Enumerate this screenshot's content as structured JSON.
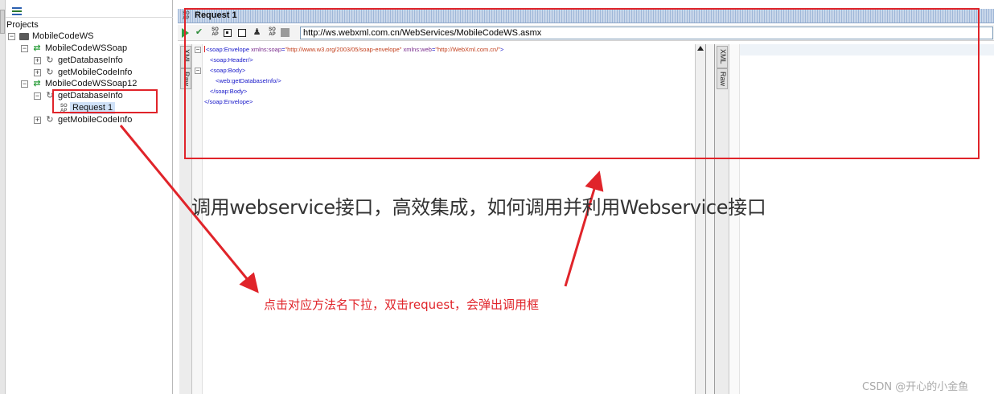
{
  "navigator": {
    "header": "Projects",
    "tree": [
      {
        "label": "MobileCodeWS",
        "icon": "project-folder-icon",
        "expander": "−"
      },
      {
        "label": "MobileCodeWSSoap",
        "icon": "soap-interface-icon",
        "expander": "−"
      },
      {
        "label": "getDatabaseInfo",
        "icon": "operation-icon",
        "expander": "+"
      },
      {
        "label": "getMobileCodeInfo",
        "icon": "operation-icon",
        "expander": "+"
      },
      {
        "label": "MobileCodeWSSoap12",
        "icon": "soap-interface-icon",
        "expander": "−"
      },
      {
        "label": "getDatabaseInfo",
        "icon": "operation-icon",
        "expander": "−"
      },
      {
        "label": "Request 1",
        "icon": "soap-request-icon",
        "expander": ""
      },
      {
        "label": "getMobileCodeInfo",
        "icon": "operation-icon",
        "expander": "+"
      }
    ]
  },
  "request_window": {
    "title": "Request 1",
    "endpoint_url": "http://ws.webxml.com.cn/WebServices/MobileCodeWS.asmx",
    "tabs": {
      "xml": "XML",
      "raw": "Raw"
    },
    "response_tabs": {
      "xml": "XML",
      "raw": "Raw"
    },
    "xml_lines": [
      {
        "indent": 0,
        "parts": [
          [
            "tag",
            "<soap:Envelope "
          ],
          [
            "attr",
            "xmlns:soap"
          ],
          [
            "tag",
            "="
          ],
          [
            "val",
            "\"http://www.w3.org/2003/05/soap-envelope\""
          ],
          [
            "tag",
            " "
          ],
          [
            "attr",
            "xmlns:web"
          ],
          [
            "tag",
            "="
          ],
          [
            "val",
            "\"http://WebXml.com.cn/\""
          ],
          [
            "tag",
            ">"
          ]
        ]
      },
      {
        "indent": 1,
        "parts": [
          [
            "tag",
            "<soap:Header/>"
          ]
        ]
      },
      {
        "indent": 1,
        "parts": [
          [
            "tag",
            "<soap:Body>"
          ]
        ]
      },
      {
        "indent": 2,
        "parts": [
          [
            "tag",
            "<web:getDatabaseInfo/>"
          ]
        ]
      },
      {
        "indent": 1,
        "parts": [
          [
            "tag",
            "</soap:Body>"
          ]
        ]
      },
      {
        "indent": 0,
        "parts": [
          [
            "tag",
            "</soap:Envelope>"
          ]
        ]
      }
    ]
  },
  "annotations": {
    "caption": "调用webservice接口，高效集成，如何调用并利用Webservice接口",
    "note": "点击对应方法名下拉，双击request，会弹出调用框",
    "watermark": "CSDN @开心的小金鱼",
    "highlight_color": "#e0242a"
  },
  "icons": {
    "run": "run-icon",
    "validate": "check-icon",
    "soap": "soap-icon"
  }
}
